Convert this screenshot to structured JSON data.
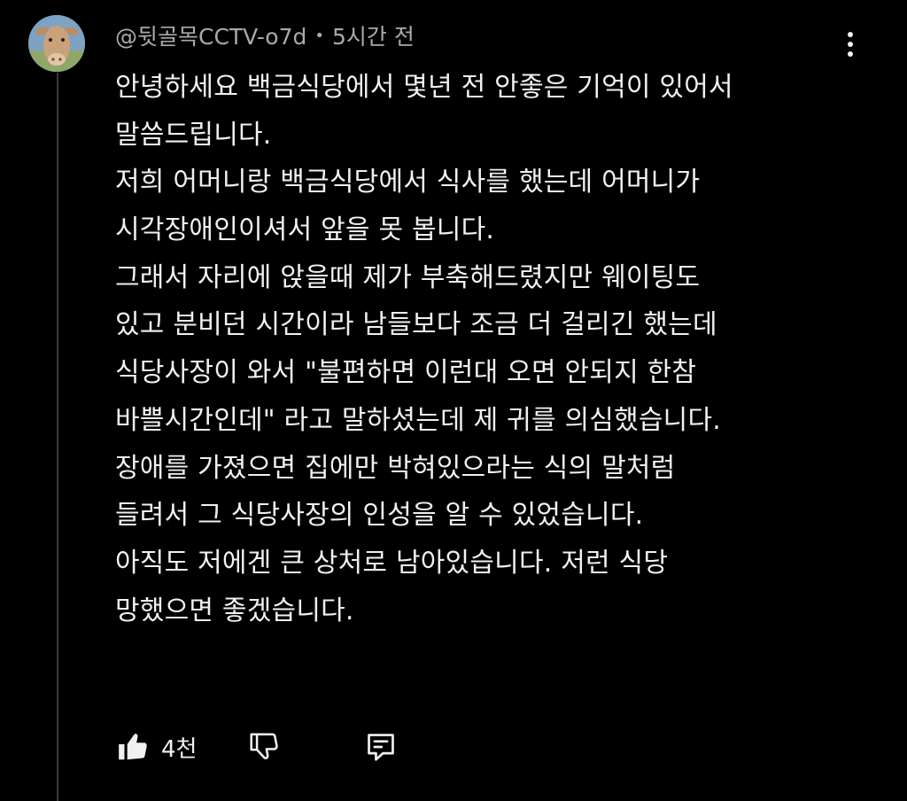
{
  "comment": {
    "author": "@뒷골목CCTV-o7d",
    "separator": "•",
    "time": "5시간 전",
    "lines": [
      "안녕하세요 백금식당에서 몇년 전 안좋은 기억이 있어서",
      "말씀드립니다.",
      "저희 어머니랑 백금식당에서 식사를 했는데 어머니가",
      "시각장애인이셔서 앞을 못 봅니다.",
      "그래서 자리에 앉을때 제가 부축해드렸지만 웨이팅도",
      "있고 분비던 시간이라 남들보다 조금 더 걸리긴 했는데",
      "식당사장이 와서 \"불편하면 이런대 오면 안되지 한참",
      "바쁠시간인데\" 라고 말하셨는데 제 귀를 의심했습니다.",
      "장애를 가졌으면 집에만 박혀있으라는 식의 말처럼",
      "들려서 그 식당사장의 인성을 알 수 있었습니다.",
      "아직도 저에겐 큰 상처로 남아있습니다. 저런 식당",
      "망했으면 좋겠습니다."
    ],
    "like_count": "4천"
  },
  "icons": {
    "avatar": "cow-avatar",
    "more": "vertical-dots-icon",
    "like": "thumbs-up-icon",
    "dislike": "thumbs-down-icon",
    "reply": "reply-comment-icon"
  },
  "colors": {
    "background": "#000000",
    "text": "#f1f1f1",
    "meta": "#aaaaaa",
    "thread_line": "#3a3a3a"
  }
}
